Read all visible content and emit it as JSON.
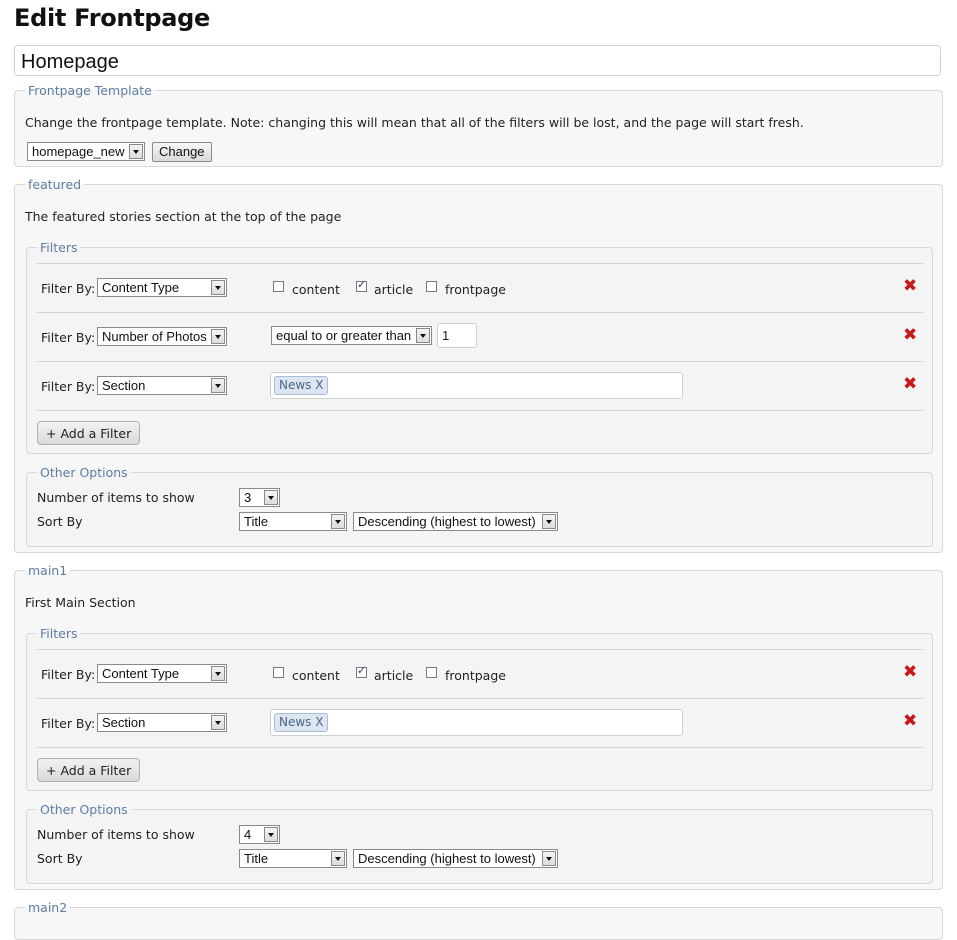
{
  "page": {
    "title": "Edit Frontpage"
  },
  "frontpage_name": "Homepage",
  "template": {
    "legend": "Frontpage Template",
    "description": "Change the frontpage template. Note: changing this will mean that all of the filters will be lost, and the page will start fresh.",
    "selected": "homepage_new",
    "change_label": "Change"
  },
  "sections": [
    {
      "legend": "featured",
      "description": "The featured stories section at the top of the page",
      "filters_legend": "Filters",
      "filters": [
        {
          "label": "Filter By:",
          "field": "Content Type",
          "options": [
            {
              "label": "content",
              "checked": false
            },
            {
              "label": "article",
              "checked": true
            },
            {
              "label": "frontpage",
              "checked": false
            }
          ]
        },
        {
          "label": "Filter By:",
          "field": "Number of Photos",
          "operator": "equal to or greater than",
          "value": "1"
        },
        {
          "label": "Filter By:",
          "field": "Section",
          "tags": [
            "News X"
          ]
        }
      ],
      "add_filter_label": "+ Add a Filter",
      "other_options_legend": "Other Options",
      "items_label": "Number of items to show",
      "items_value": "3",
      "sort_label": "Sort By",
      "sort_field": "Title",
      "sort_order": "Descending (highest to lowest)"
    },
    {
      "legend": "main1",
      "description": "First Main Section",
      "filters_legend": "Filters",
      "filters": [
        {
          "label": "Filter By:",
          "field": "Content Type",
          "options": [
            {
              "label": "content",
              "checked": false
            },
            {
              "label": "article",
              "checked": true
            },
            {
              "label": "frontpage",
              "checked": false
            }
          ]
        },
        {
          "label": "Filter By:",
          "field": "Section",
          "tags": [
            "News X"
          ]
        }
      ],
      "add_filter_label": "+ Add a Filter",
      "other_options_legend": "Other Options",
      "items_label": "Number of items to show",
      "items_value": "4",
      "sort_label": "Sort By",
      "sort_field": "Title",
      "sort_order": "Descending (highest to lowest)"
    },
    {
      "legend": "main2"
    }
  ],
  "colors": {
    "legend": "#5c7da3",
    "remove": "#c41a1a",
    "panel": "#f7f7f7"
  },
  "icons": {
    "remove": "red-x-icon",
    "dropdown": "chevron-down-icon",
    "checked": "checkmark-icon"
  }
}
